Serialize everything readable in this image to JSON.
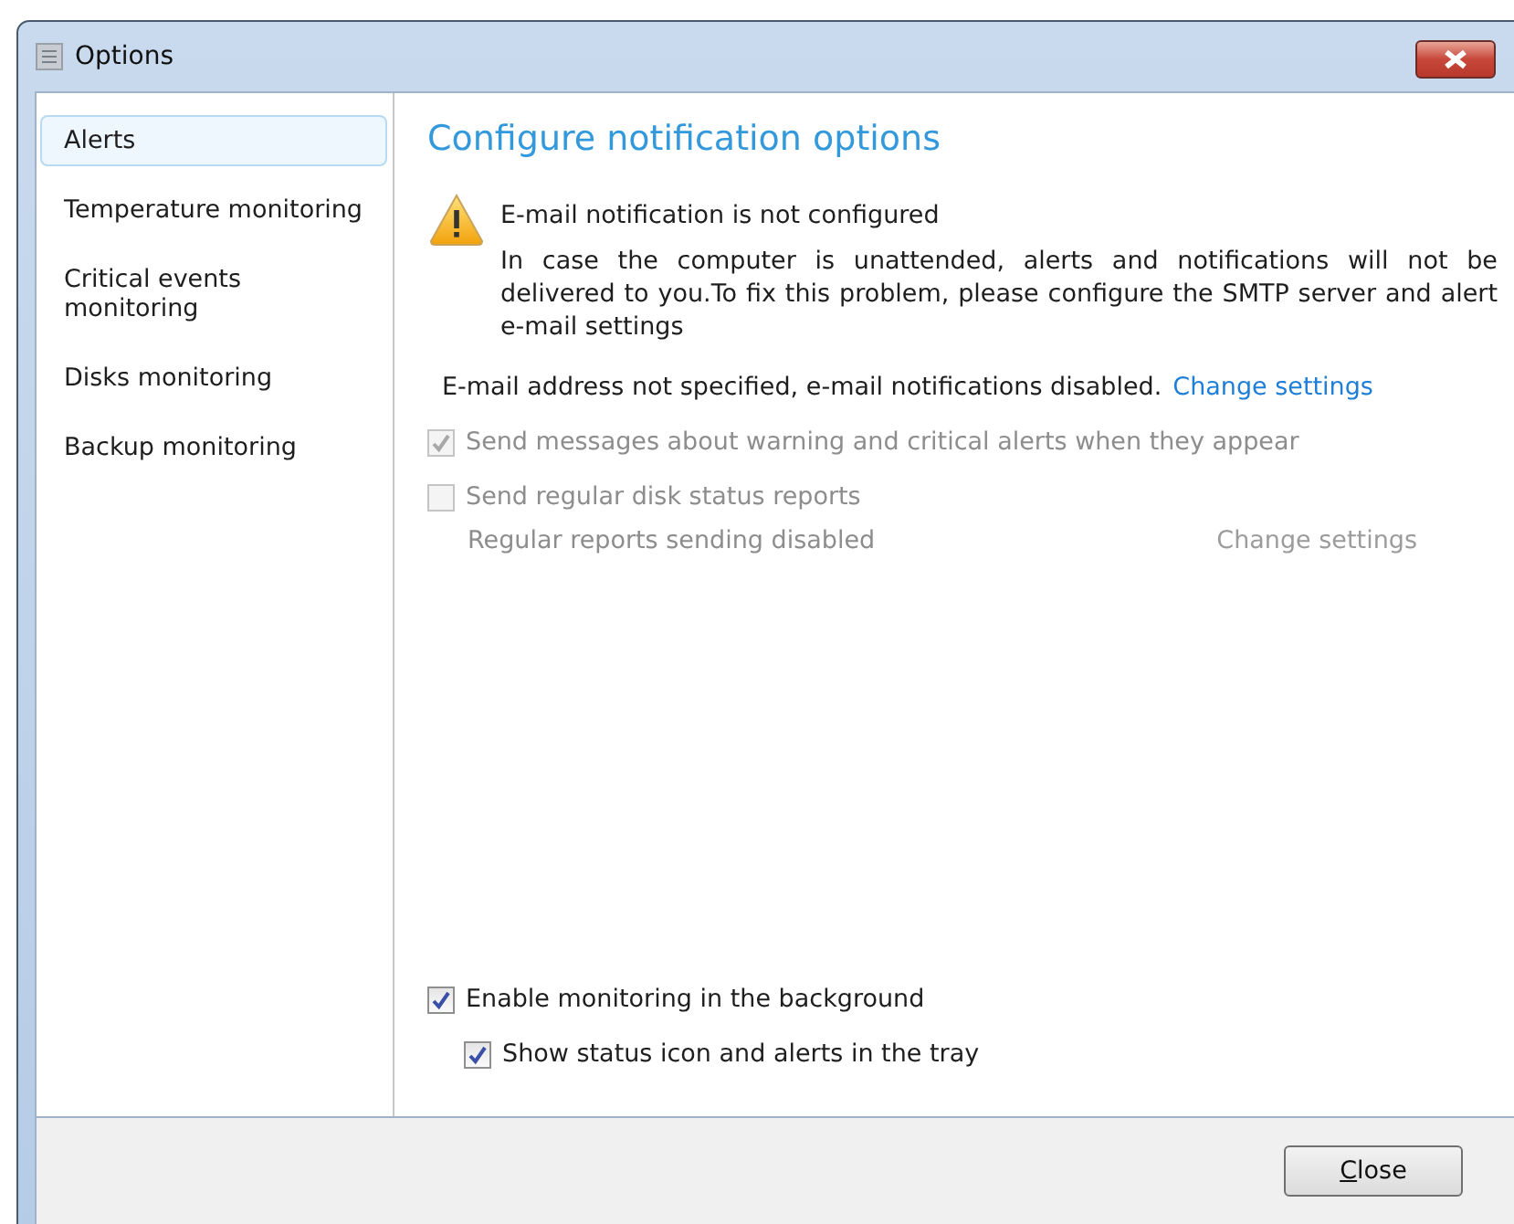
{
  "window": {
    "title": "Options"
  },
  "sidebar": {
    "items": [
      {
        "label": "Alerts",
        "selected": true
      },
      {
        "label": "Temperature monitoring",
        "selected": false
      },
      {
        "label": "Critical events monitoring",
        "selected": false
      },
      {
        "label": "Disks monitoring",
        "selected": false
      },
      {
        "label": "Backup monitoring",
        "selected": false
      }
    ]
  },
  "content": {
    "heading": "Configure notification options",
    "warning": {
      "title": "E-mail notification is not configured",
      "text": "In case the computer is unattended, alerts and notifications will not be delivered to you.To fix this problem, please configure the SMTP server and alert e-mail settings"
    },
    "email_status": {
      "text": "E-mail address not specified, e-mail notifications disabled.",
      "link": "Change settings"
    },
    "send_alerts": {
      "label": "Send messages about warning and critical alerts when they appear",
      "checked": true,
      "disabled": true
    },
    "send_reports": {
      "label": "Send regular disk status reports",
      "checked": false,
      "disabled": true
    },
    "reports_status": {
      "text": "Regular reports sending disabled",
      "link": "Change settings",
      "disabled": true
    },
    "enable_background": {
      "label": "Enable monitoring in the background",
      "checked": true,
      "disabled": false
    },
    "show_tray": {
      "label": "Show status icon and alerts in the tray",
      "checked": true,
      "disabled": false
    }
  },
  "buttons": [
    "Close"
  ]
}
